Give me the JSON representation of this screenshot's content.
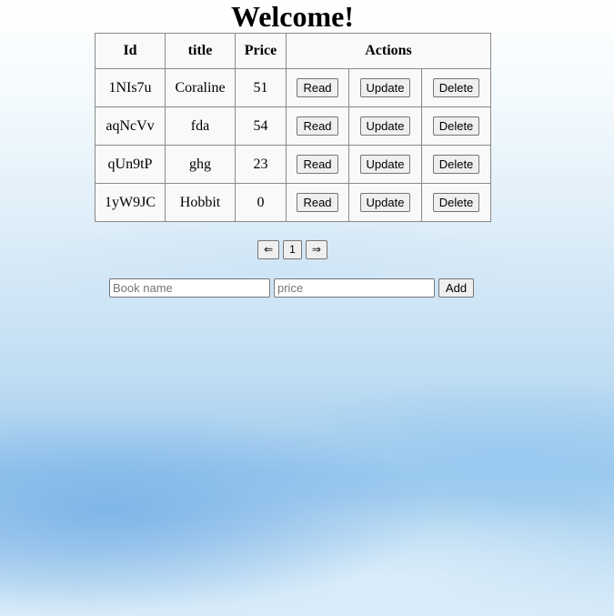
{
  "page": {
    "title": "Welcome!"
  },
  "table": {
    "headers": {
      "id": "Id",
      "title": "title",
      "price": "Price",
      "actions": "Actions"
    },
    "rows": [
      {
        "id": "1NIs7u",
        "title": "Coraline",
        "price": "51",
        "read": "Read",
        "update": "Update",
        "delete": "Delete"
      },
      {
        "id": "aqNcVv",
        "title": "fda",
        "price": "54",
        "read": "Read",
        "update": "Update",
        "delete": "Delete"
      },
      {
        "id": "qUn9tP",
        "title": "ghg",
        "price": "23",
        "read": "Read",
        "update": "Update",
        "delete": "Delete"
      },
      {
        "id": "1yW9JC",
        "title": "Hobbit",
        "price": "0",
        "read": "Read",
        "update": "Update",
        "delete": "Delete"
      }
    ]
  },
  "pagination": {
    "prev_label": "⇐",
    "pages": [
      "1"
    ],
    "next_label": "⇒"
  },
  "add_form": {
    "book_name_placeholder": "Book name",
    "book_name_value": "",
    "price_placeholder": "price",
    "price_value": "",
    "add_label": "Add"
  }
}
